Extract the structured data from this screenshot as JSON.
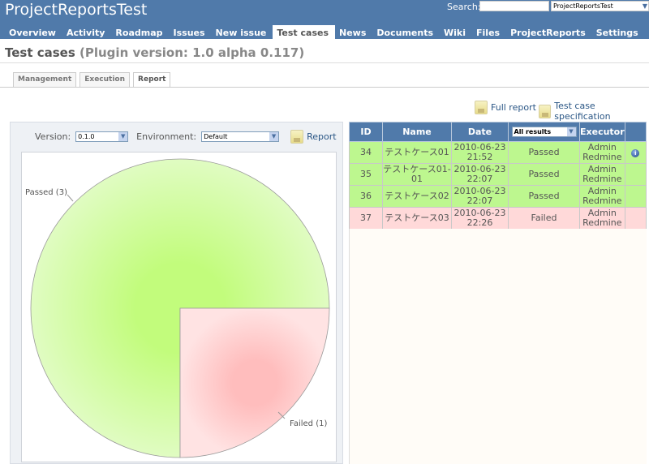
{
  "header": {
    "title": "ProjectReportsTest",
    "search_label": "Search:",
    "search_value": "",
    "project_select": "ProjectReportsTest"
  },
  "nav": [
    {
      "label": "Overview"
    },
    {
      "label": "Activity"
    },
    {
      "label": "Roadmap"
    },
    {
      "label": "Issues"
    },
    {
      "label": "New issue"
    },
    {
      "label": "Test cases",
      "selected": true
    },
    {
      "label": "News"
    },
    {
      "label": "Documents"
    },
    {
      "label": "Wiki"
    },
    {
      "label": "Files"
    },
    {
      "label": "ProjectReports"
    },
    {
      "label": "Settings"
    }
  ],
  "page": {
    "title": "Test cases",
    "subtitle": "(Plugin version: 1.0 alpha 0.117)"
  },
  "tabs": [
    {
      "label": "Management"
    },
    {
      "label": "Execution"
    },
    {
      "label": "Report",
      "selected": true
    }
  ],
  "links": {
    "full_report": "Full report",
    "spec": "Test case specification"
  },
  "filters": {
    "version_label": "Version:",
    "version_value": "0.1.0",
    "env_label": "Environment:",
    "env_value": "Default",
    "report_label": "Report"
  },
  "chart_data": {
    "type": "pie",
    "slices": [
      {
        "label": "Passed (3)",
        "value": 3,
        "color": "#c2fc7c"
      },
      {
        "label": "Failed (1)",
        "value": 1,
        "color": "#ffbdbd"
      }
    ]
  },
  "table": {
    "headers": {
      "id": "ID",
      "name": "Name",
      "date": "Date",
      "result_filter": "All results",
      "executor": "Executor"
    },
    "rows": [
      {
        "id": "34",
        "name": "テストケース01",
        "date1": "2010-06-23",
        "date2": "21:52",
        "result": "Passed",
        "exec1": "Admin",
        "exec2": "Redmine",
        "info": true,
        "status": "passed"
      },
      {
        "id": "35",
        "name": "テストケース01-01",
        "date1": "2010-06-23",
        "date2": "22:07",
        "result": "Passed",
        "exec1": "Admin",
        "exec2": "Redmine",
        "info": false,
        "status": "passed"
      },
      {
        "id": "36",
        "name": "テストケース02",
        "date1": "2010-06-23",
        "date2": "22:07",
        "result": "Passed",
        "exec1": "Admin",
        "exec2": "Redmine",
        "info": false,
        "status": "passed"
      },
      {
        "id": "37",
        "name": "テストケース03",
        "date1": "2010-06-23",
        "date2": "22:26",
        "result": "Failed",
        "exec1": "Admin",
        "exec2": "Redmine",
        "info": false,
        "status": "failed"
      }
    ]
  }
}
